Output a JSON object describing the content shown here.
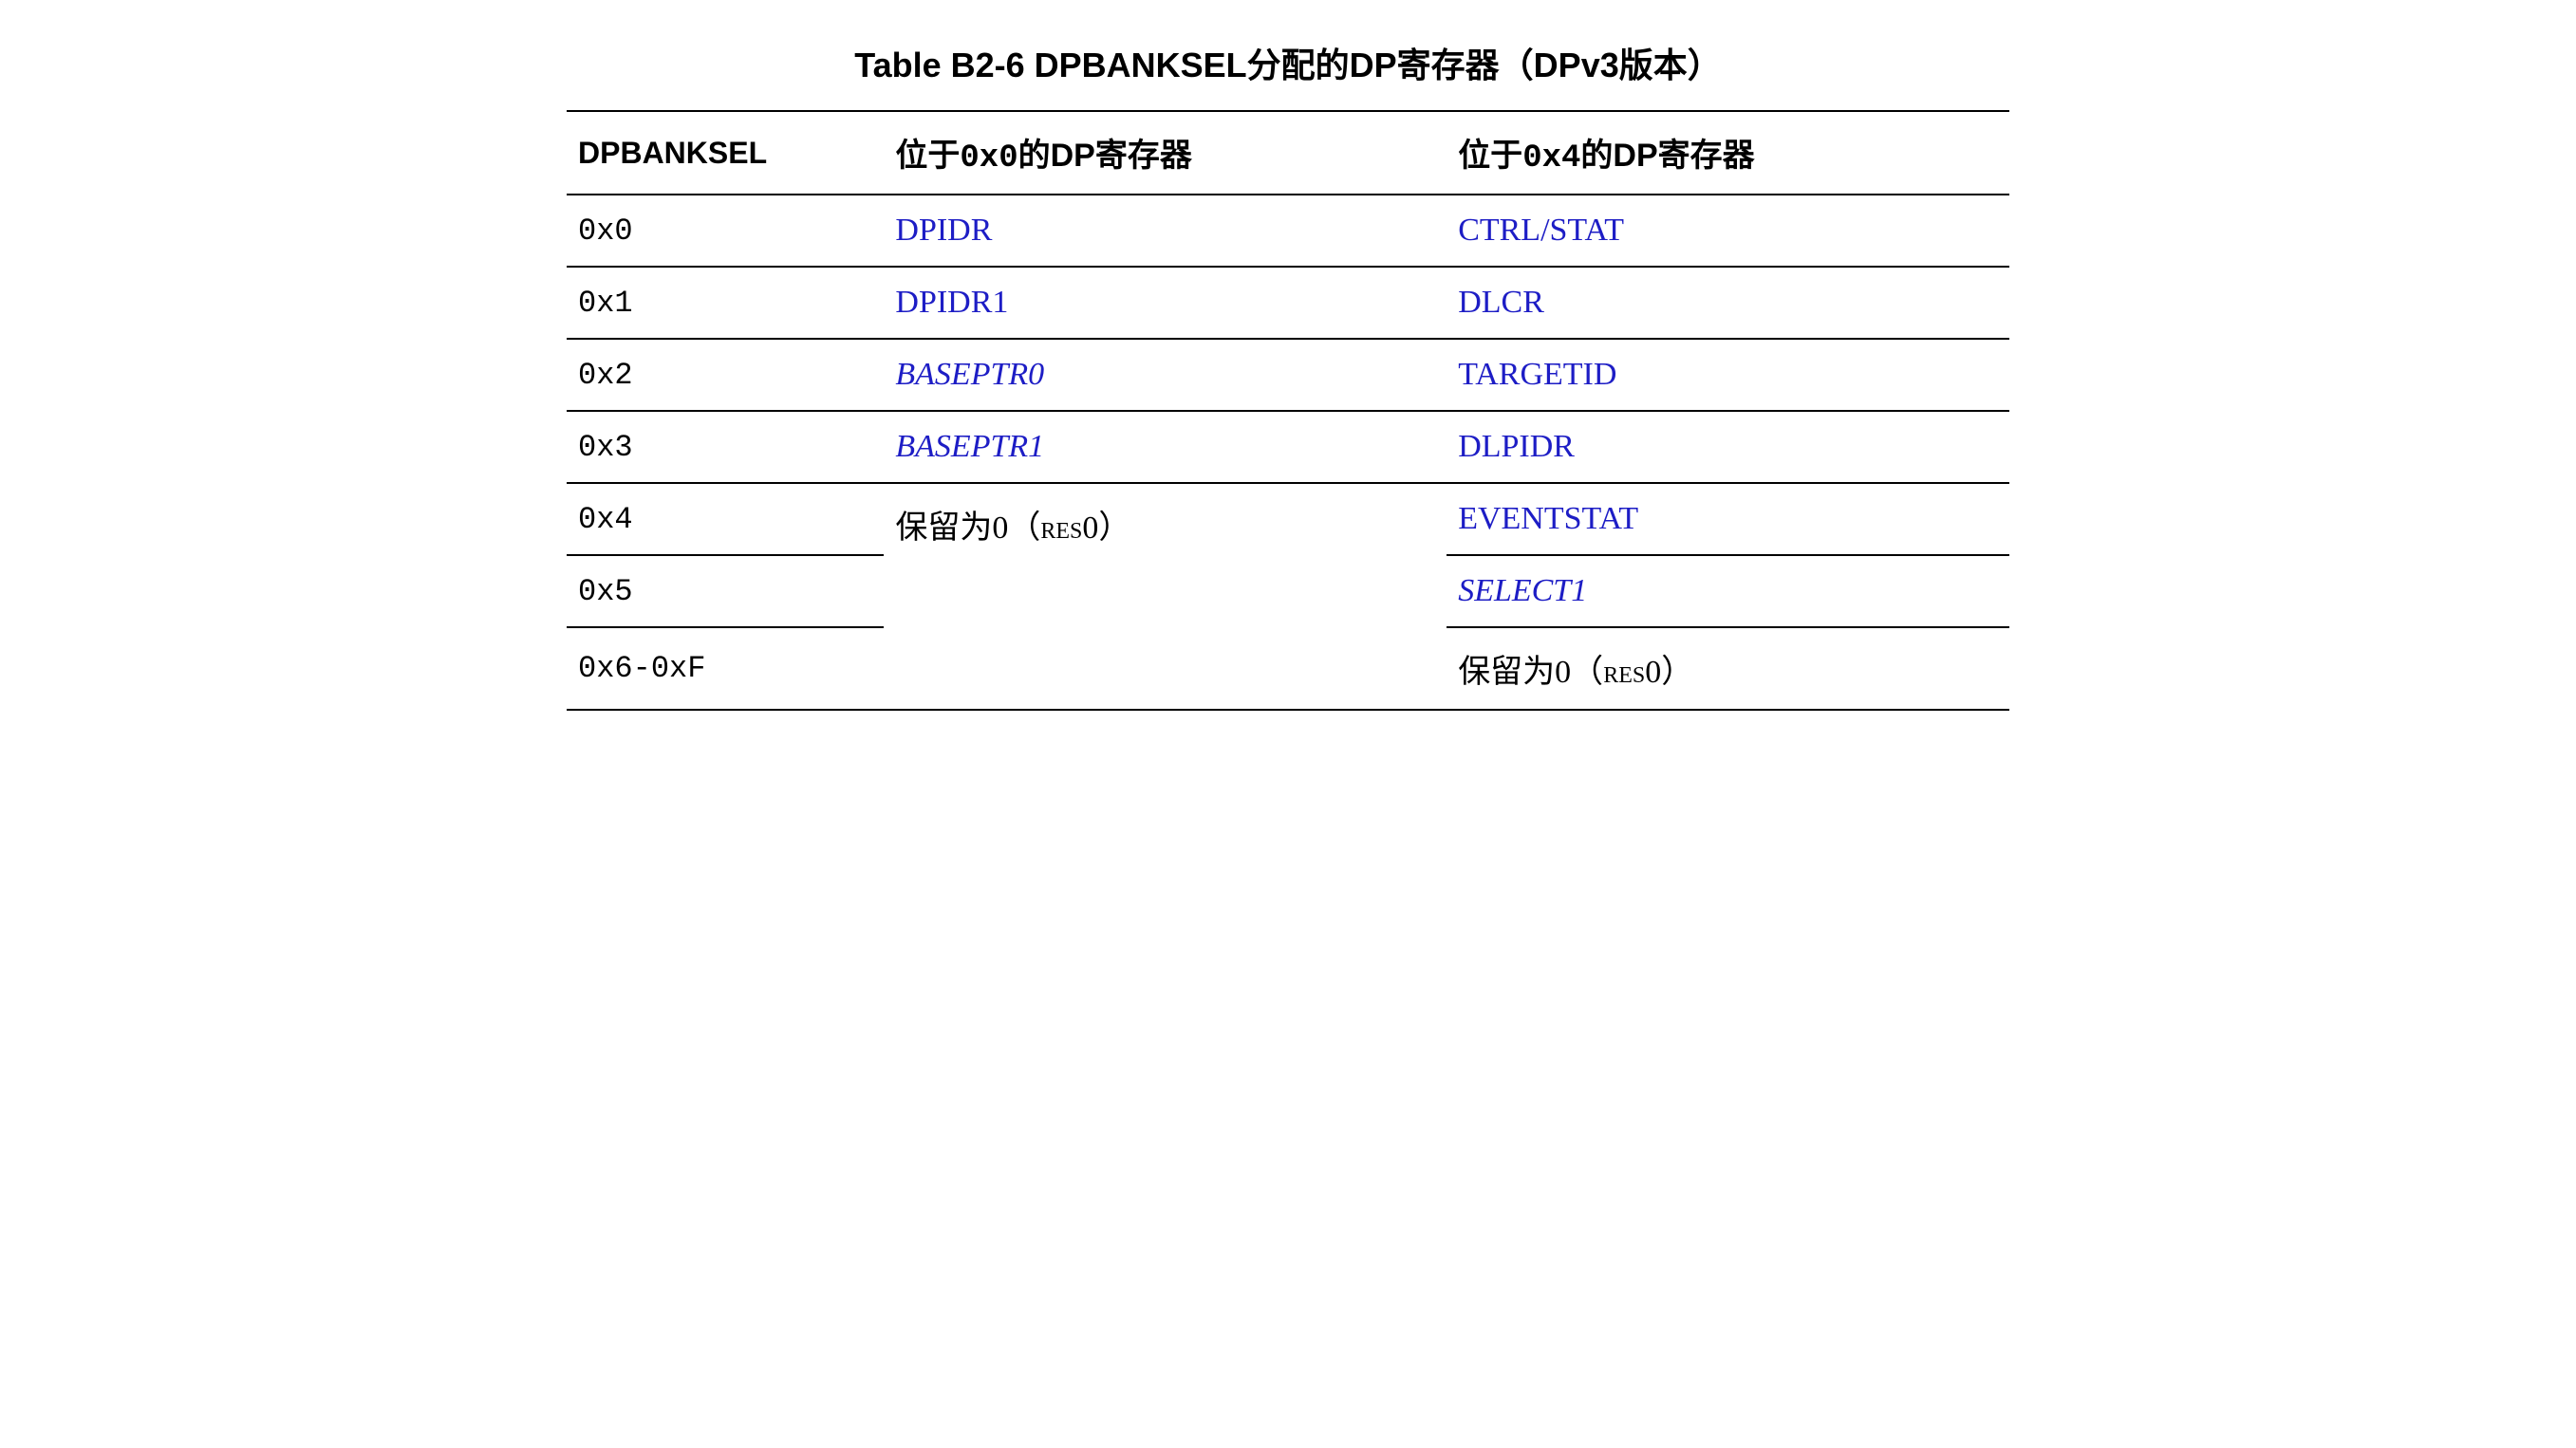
{
  "title": "Table B2-6 DPBANKSEL分配的DP寄存器（DPv3版本）",
  "headers": {
    "col1": "DPBANKSEL",
    "col2_prefix": "位于",
    "col2_addr": "0x0",
    "col2_suffix": "的DP寄存器",
    "col3_prefix": "位于",
    "col3_addr": "0x4",
    "col3_suffix": "的DP寄存器"
  },
  "rows": {
    "r0": {
      "sel": "0x0",
      "reg0": "DPIDR",
      "reg4": "CTRL/STAT"
    },
    "r1": {
      "sel": "0x1",
      "reg0": "DPIDR1",
      "reg4": "DLCR"
    },
    "r2": {
      "sel": "0x2",
      "reg0": "BASEPTR0",
      "reg4": "TARGETID"
    },
    "r3": {
      "sel": "0x3",
      "reg0": "BASEPTR1",
      "reg4": "DLPIDR"
    },
    "r4": {
      "sel": "0x4",
      "reg0_prefix": "保留为0（",
      "reg0_res": "res0",
      "reg0_suffix": "）",
      "reg4": "EVENTSTAT"
    },
    "r5": {
      "sel": "0x5",
      "reg4": "SELECT1"
    },
    "r6": {
      "sel": "0x6-0xF",
      "reg4_prefix": "保留为0（",
      "reg4_res": "res0",
      "reg4_suffix": "）"
    }
  }
}
